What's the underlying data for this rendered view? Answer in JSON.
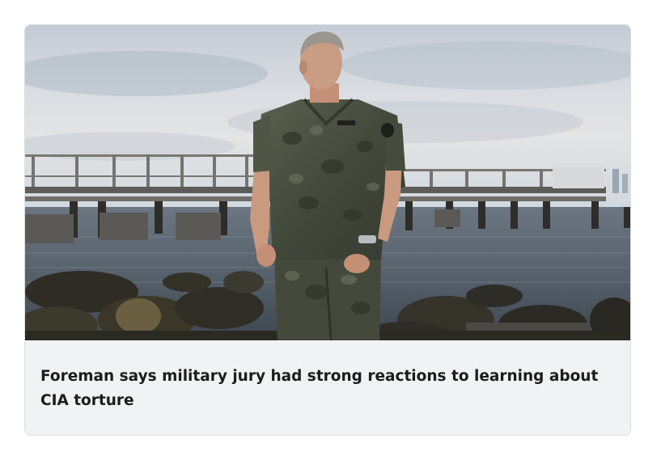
{
  "article": {
    "headline": "Foreman says military jury had strong reactions to learning about CIA torture",
    "image": {
      "subject": "man in navy camouflage uniform standing on rocky shoreline in front of a pier",
      "colors": {
        "sky": "#c9d3dc",
        "water": "#4a5763",
        "rocks": "#2b2a22",
        "uniform": "#4c5444",
        "pier": "#6c6a66"
      }
    }
  }
}
